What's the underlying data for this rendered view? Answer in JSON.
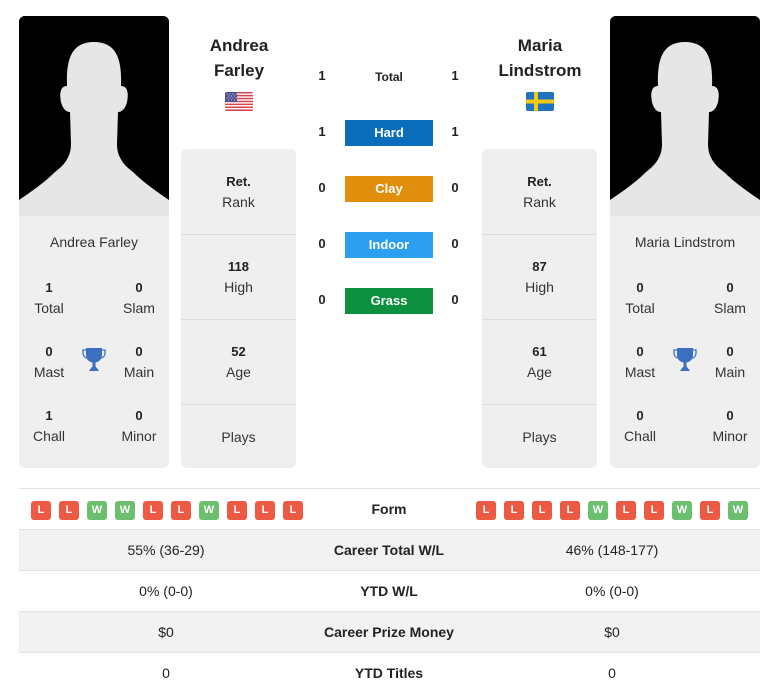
{
  "player_left": {
    "name_line1": "Andrea",
    "name_line2": "Farley",
    "full_name": "Andrea Farley",
    "flag": "usa-flag",
    "titles": {
      "total": "1",
      "total_label": "Total",
      "slam": "0",
      "slam_label": "Slam",
      "mast": "0",
      "mast_label": "Mast",
      "main": "0",
      "main_label": "Main",
      "chall": "1",
      "chall_label": "Chall",
      "minor": "0",
      "minor_label": "Minor"
    },
    "info": {
      "rank_value": "Ret.",
      "rank_label": "Rank",
      "high_value": "118",
      "high_label": "High",
      "age_value": "52",
      "age_label": "Age",
      "plays_label": "Plays"
    },
    "form": [
      "L",
      "L",
      "W",
      "W",
      "L",
      "L",
      "W",
      "L",
      "L",
      "L"
    ],
    "career_wl": "55% (36-29)",
    "ytd_wl": "0% (0-0)",
    "prize_money": "$0",
    "ytd_titles": "0"
  },
  "player_right": {
    "name_line1": "Maria",
    "name_line2": "Lindstrom",
    "full_name": "Maria Lindstrom",
    "flag": "sweden-flag",
    "titles": {
      "total": "0",
      "total_label": "Total",
      "slam": "0",
      "slam_label": "Slam",
      "mast": "0",
      "mast_label": "Mast",
      "main": "0",
      "main_label": "Main",
      "chall": "0",
      "chall_label": "Chall",
      "minor": "0",
      "minor_label": "Minor"
    },
    "info": {
      "rank_value": "Ret.",
      "rank_label": "Rank",
      "high_value": "87",
      "high_label": "High",
      "age_value": "61",
      "age_label": "Age",
      "plays_label": "Plays"
    },
    "form": [
      "L",
      "L",
      "L",
      "L",
      "W",
      "L",
      "L",
      "W",
      "L",
      "W"
    ],
    "career_wl": "46% (148-177)",
    "ytd_wl": "0% (0-0)",
    "prize_money": "$0",
    "ytd_titles": "0"
  },
  "h2h": [
    {
      "label": "Total",
      "left": "1",
      "right": "1",
      "color": ""
    },
    {
      "label": "Hard",
      "left": "1",
      "right": "1",
      "color": "#0a6ebd"
    },
    {
      "label": "Clay",
      "left": "0",
      "right": "0",
      "color": "#e08e0b"
    },
    {
      "label": "Indoor",
      "left": "0",
      "right": "0",
      "color": "#2c9ff0"
    },
    {
      "label": "Grass",
      "left": "0",
      "right": "0",
      "color": "#0c9140"
    }
  ],
  "comparison": {
    "form_label": "Form",
    "career_wl_label": "Career Total W/L",
    "ytd_wl_label": "YTD W/L",
    "prize_money_label": "Career Prize Money",
    "ytd_titles_label": "YTD Titles"
  },
  "colors": {
    "loss": "#ec5a44",
    "win": "#6bbf6e",
    "trophy": "#3c6fbf"
  }
}
